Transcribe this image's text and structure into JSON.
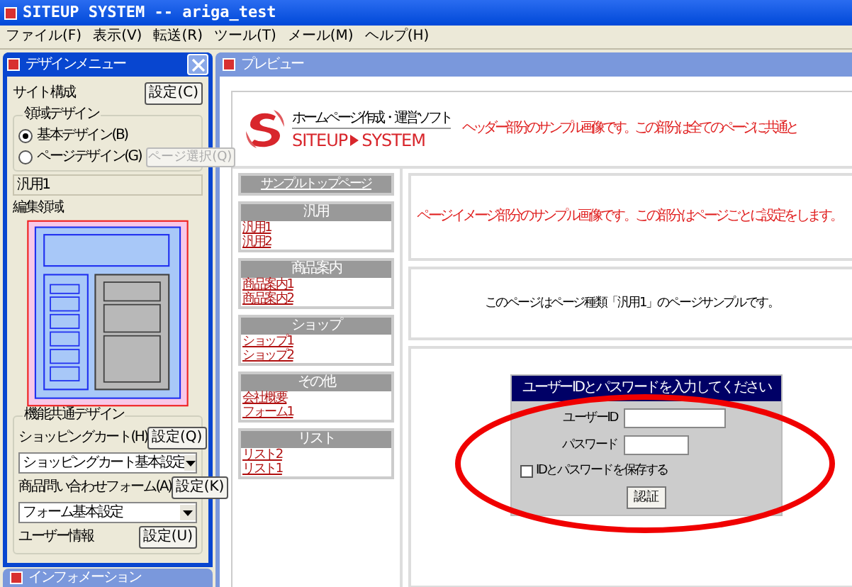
{
  "app_window": {
    "title": "SITEUP SYSTEM -- ariga_test"
  },
  "menu_bar": [
    "ファイル(F)",
    "表示(V)",
    "転送(R)",
    "ツール(T)",
    "メール(M)",
    "ヘルプ(H)"
  ],
  "design_menu": {
    "title": "デザインメニュー",
    "site_label": "サイト構成",
    "site_button": "設定(C)",
    "region_group": "領域デザイン",
    "radios": [
      {
        "label": "基本デザイン(B)",
        "selected": true
      },
      {
        "label": "ページデザイン(G)",
        "selected": false
      }
    ],
    "page_select_button": {
      "label": "ページ選択(Q)",
      "disabled": true
    },
    "page_field": "汎用1",
    "edit_area_label": "編集領域",
    "common_group": "機能共通デザイン",
    "settings": [
      {
        "kind": "select",
        "label": "ショッピングカート(H)",
        "button": "設定(Q)",
        "value": "ショッピングカート基本設定"
      },
      {
        "kind": "select",
        "label": "商品問い合わせフォーム(A)",
        "button": "設定(K)",
        "value": "フォーム基本設定"
      },
      {
        "kind": "plain",
        "label": "ユーザー情報",
        "button": "設定(U)"
      }
    ]
  },
  "info_window": {
    "title": "インフォメーション"
  },
  "preview": {
    "title": "プレビュー",
    "header": {
      "tagline": "ホームページ作成・運営ソフト",
      "logo_left": "SITEUP",
      "logo_right": "SYSTEM",
      "note": "ヘッダー部分のサンプル画像です。この部分は全てのページに共通と"
    },
    "nav_top": "サンプルトップページ",
    "nav_groups": [
      {
        "title": "汎用",
        "links": [
          "汎用1",
          "汎用2"
        ]
      },
      {
        "title": "商品案内",
        "links": [
          "商品案内1",
          "商品案内2"
        ]
      },
      {
        "title": "ショップ",
        "links": [
          "ショップ1",
          "ショップ2"
        ]
      },
      {
        "title": "その他",
        "links": [
          "会社概要",
          "フォーム1"
        ]
      },
      {
        "title": "リスト",
        "links": [
          "リスト2",
          "リスト1"
        ]
      }
    ],
    "page_image": {
      "note": "ページイメージ部分のサンプル画像です。この部分はページごとに設定をします。"
    },
    "page_note": "このページはページ種類「汎用1」のページサンプルです。",
    "login": {
      "title": "ユーザーIDとパスワードを入力してください",
      "fields": [
        {
          "label": "ユーザーID"
        },
        {
          "label": "パスワード"
        }
      ],
      "remember": {
        "label": "IDとパスワードを保存する",
        "checked": false
      },
      "button": "認証"
    }
  }
}
